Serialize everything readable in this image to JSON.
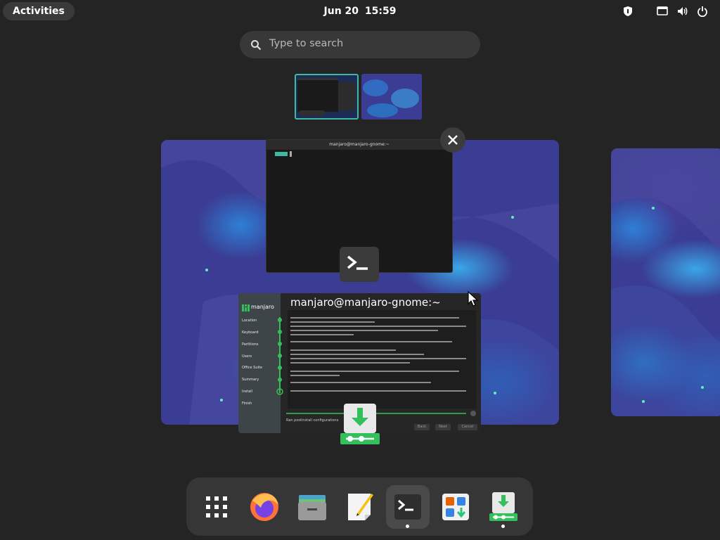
{
  "topbar": {
    "activities_label": "Activities",
    "date": "Jun 20",
    "time": "15:59",
    "tray_icons": [
      "shield-icon",
      "display-icon",
      "volume-icon",
      "power-icon"
    ]
  },
  "search": {
    "placeholder": "Type to search"
  },
  "workspaces": {
    "thumbnails": [
      "workspace-1",
      "workspace-2"
    ],
    "active_index": 0
  },
  "windows": {
    "terminal": {
      "title": "manjaro@manjaro-gnome:~",
      "icon": "terminal-icon"
    },
    "installer": {
      "title": "manjaro@manjaro-gnome:~",
      "brand": "manjaro",
      "steps": [
        "Location",
        "Keyboard",
        "Partitions",
        "Users",
        "Office Suite",
        "Summary",
        "Install",
        "Finish"
      ],
      "status_text": "Ran postinstall configurations",
      "buttons": [
        "Back",
        "Next",
        "Cancel"
      ],
      "icon": "installer-icon"
    }
  },
  "dash": {
    "items": [
      {
        "name": "show-apps",
        "icon": "grid-icon",
        "running": false
      },
      {
        "name": "firefox",
        "icon": "firefox-icon",
        "running": false
      },
      {
        "name": "files",
        "icon": "files-icon",
        "running": false
      },
      {
        "name": "text-editor",
        "icon": "text-editor-icon",
        "running": false
      },
      {
        "name": "terminal",
        "icon": "terminal-icon",
        "running": true
      },
      {
        "name": "software",
        "icon": "software-icon",
        "running": false
      },
      {
        "name": "installer",
        "icon": "installer-icon",
        "running": true
      }
    ]
  },
  "colors": {
    "accent": "#3fb9a4",
    "panel": "#242424",
    "dash_bg": "#363636"
  }
}
